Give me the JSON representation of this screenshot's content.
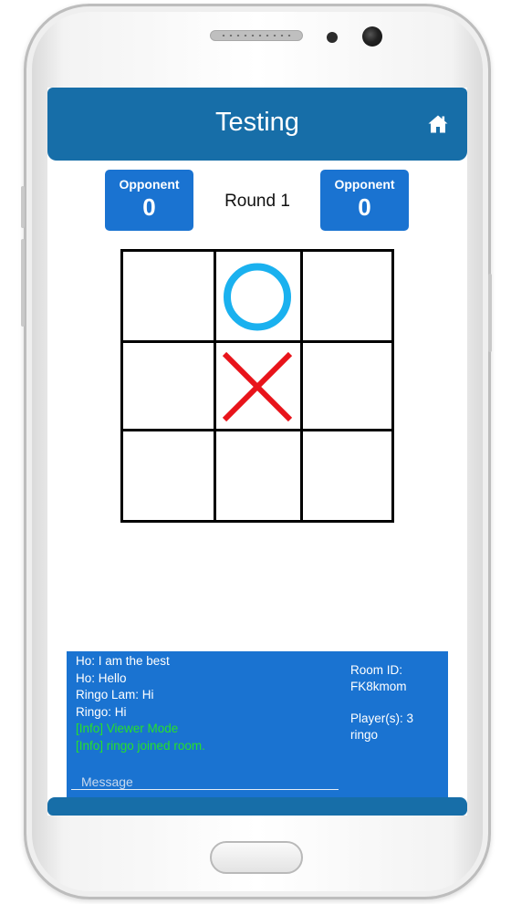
{
  "app": {
    "title": "Testing"
  },
  "scoreboard": {
    "left": {
      "label": "Opponent",
      "score": "0"
    },
    "right": {
      "label": "Opponent",
      "score": "0"
    },
    "round": "Round 1"
  },
  "board": {
    "cells": [
      [
        "",
        "O",
        ""
      ],
      [
        "",
        "X",
        ""
      ],
      [
        "",
        "",
        ""
      ]
    ],
    "o_color": "#1ab1ef",
    "x_color": "#e8141b"
  },
  "chat": {
    "messages": [
      {
        "text": "Ho: I am the best",
        "type": "user"
      },
      {
        "text": "Ho: Hello",
        "type": "user"
      },
      {
        "text": "Ringo Lam: Hi",
        "type": "user"
      },
      {
        "text": "Ringo: Hi",
        "type": "user"
      },
      {
        "text": "[Info] Viewer Mode",
        "type": "info"
      },
      {
        "text": "[Info] ringo joined room.",
        "type": "info"
      }
    ],
    "input_placeholder": "Message"
  },
  "room": {
    "id_label": "Room ID:",
    "id": "FK8kmom",
    "players_label": "Player(s): 3",
    "player_name": "ringo"
  },
  "colors": {
    "app_bar": "#176ea8",
    "panel": "#1a73d1",
    "info_text": "#26e02a"
  },
  "icons": {
    "home": "home-icon"
  }
}
